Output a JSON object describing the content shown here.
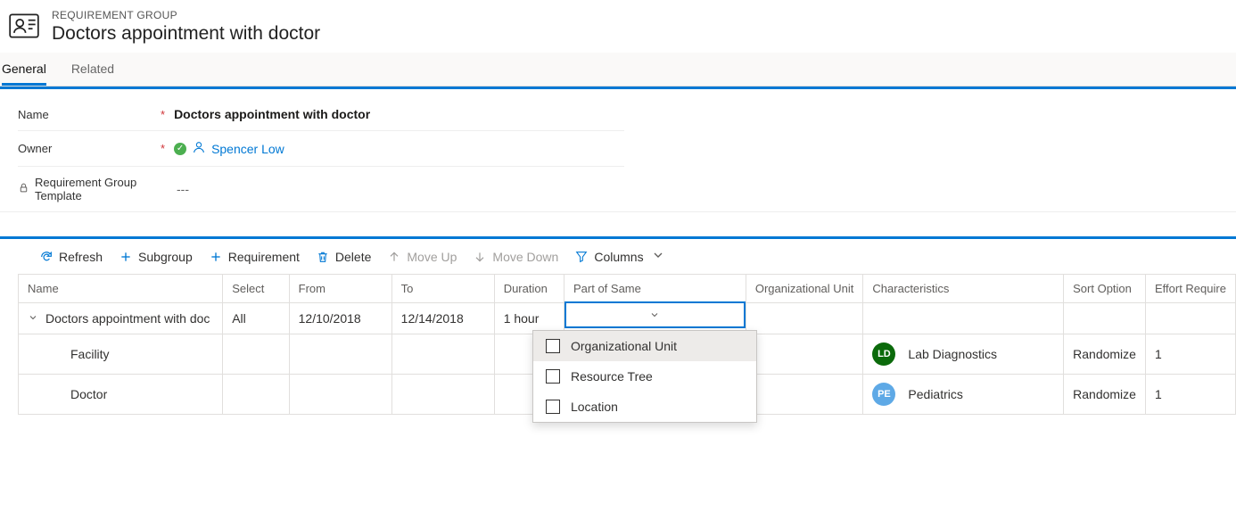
{
  "header": {
    "label": "REQUIREMENT GROUP",
    "title": "Doctors appointment with doctor"
  },
  "tabs": {
    "general": "General",
    "related": "Related"
  },
  "form": {
    "name_label": "Name",
    "name_value": "Doctors appointment with doctor",
    "owner_label": "Owner",
    "owner_value": "Spencer Low",
    "template_label": "Requirement Group Template",
    "template_value": "---"
  },
  "toolbar": {
    "refresh": "Refresh",
    "subgroup": "Subgroup",
    "requirement": "Requirement",
    "delete": "Delete",
    "move_up": "Move Up",
    "move_down": "Move Down",
    "columns": "Columns"
  },
  "columns": {
    "name": "Name",
    "select": "Select",
    "from": "From",
    "to": "To",
    "duration": "Duration",
    "part_of_same": "Part of Same",
    "org_unit": "Organizational Unit",
    "characteristics": "Characteristics",
    "sort_option": "Sort Option",
    "effort_required": "Effort Require"
  },
  "rows": {
    "r0": {
      "name": "Doctors appointment with doc",
      "select": "All",
      "from": "12/10/2018",
      "to": "12/14/2018",
      "duration": "1 hour"
    },
    "r1": {
      "name": "Facility",
      "char_initials": "LD",
      "char_label": "Lab Diagnostics",
      "sort": "Randomize",
      "effort": "1"
    },
    "r2": {
      "name": "Doctor",
      "char_initials": "PE",
      "char_label": "Pediatrics",
      "sort": "Randomize",
      "effort": "1"
    }
  },
  "dropdown": {
    "opt1": "Organizational Unit",
    "opt2": "Resource Tree",
    "opt3": "Location"
  }
}
